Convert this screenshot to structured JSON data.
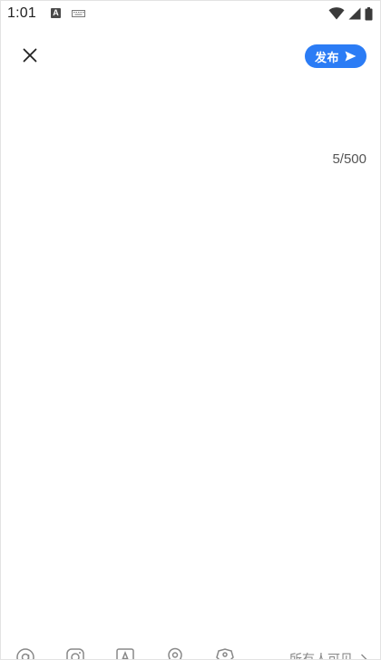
{
  "status_bar": {
    "time": "1:01",
    "left_icons": [
      "a-badge-icon",
      "keyboard-icon"
    ],
    "right_icons": [
      "wifi-icon",
      "signal-icon",
      "battery-icon"
    ]
  },
  "header": {
    "publish_label": "发布",
    "accent_color": "#2b7cf5"
  },
  "editor": {
    "value": "",
    "counter": "5/500"
  },
  "toolbar": {
    "icons": [
      "at-icon",
      "instagram-icon",
      "text-style-icon",
      "location-icon",
      "tag-icon"
    ],
    "visibility_label": "所有人可见"
  }
}
